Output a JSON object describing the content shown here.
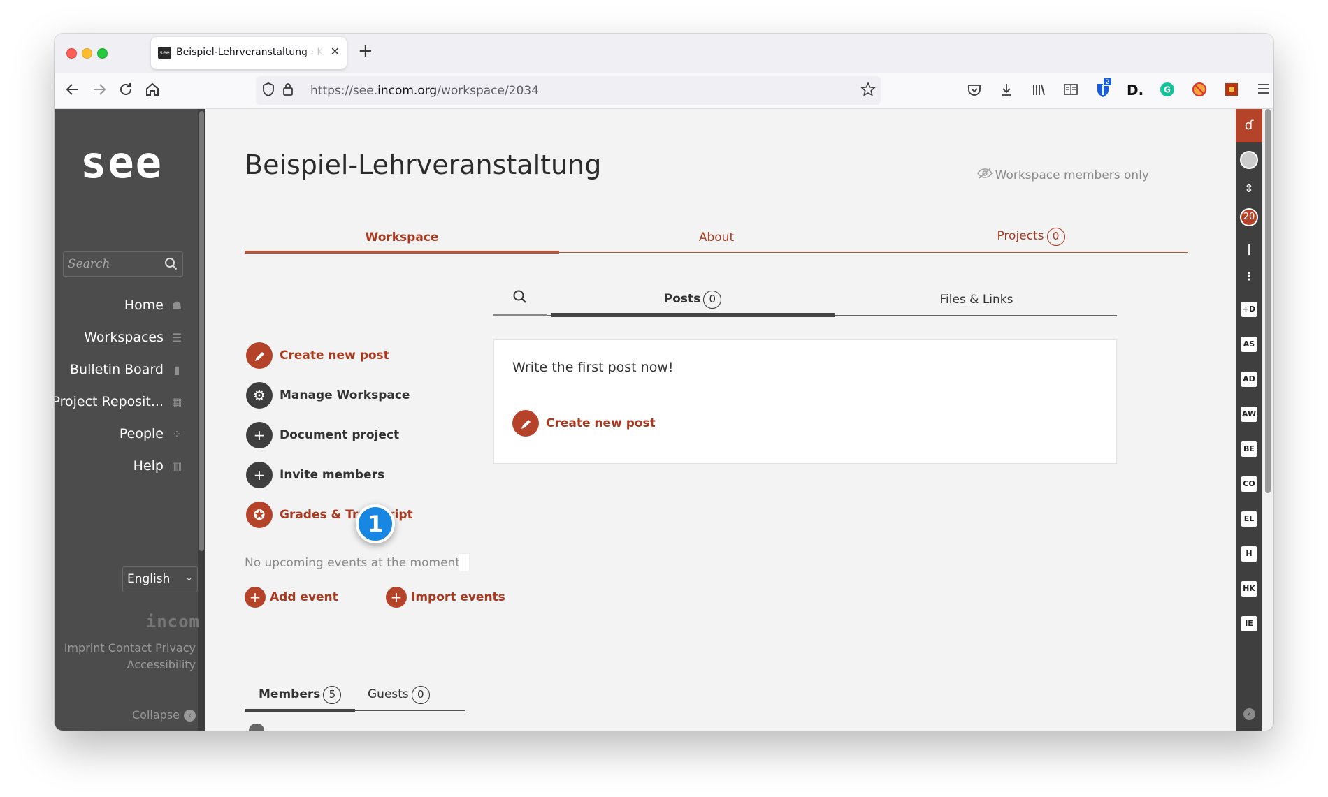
{
  "browser": {
    "tab_title": "Beispiel-Lehrveranstaltung · KHI",
    "favicon_text": "see",
    "url_prefix": "https://see.",
    "url_domain": "incom.org",
    "url_path": "/workspace/2034",
    "toolbar_icons": [
      "pocket-icon",
      "download-icon",
      "library-icon",
      "reader-icon",
      "bitwarden-icon",
      "dashlane-icon",
      "grammarly-icon",
      "blocker-icon",
      "extension-icon",
      "menu-icon"
    ],
    "bitwarden_badge": "2"
  },
  "sidebar": {
    "logo": "see",
    "search_placeholder": "Search",
    "items": [
      {
        "label": "Home",
        "icon": "home-icon"
      },
      {
        "label": "Workspaces",
        "icon": "list-icon"
      },
      {
        "label": "Bulletin Board",
        "icon": "clipboard-icon"
      },
      {
        "label": "Project Reposit...",
        "icon": "grid-icon"
      },
      {
        "label": "People",
        "icon": "people-icon"
      },
      {
        "label": "Help",
        "icon": "book-icon"
      }
    ],
    "language": "English",
    "brand": "incom",
    "footer_line1": "Imprint Contact Privacy",
    "footer_line2": "Accessibility",
    "collapse": "Collapse"
  },
  "workspace": {
    "title": "Beispiel-Lehrveranstaltung",
    "visibility": "Workspace members only",
    "tabs": [
      {
        "label": "Workspace",
        "count": null
      },
      {
        "label": "About",
        "count": null
      },
      {
        "label": "Projects",
        "count": "0"
      }
    ],
    "actions": [
      {
        "label": "Create new post",
        "icon": "pencil-icon",
        "style": "red"
      },
      {
        "label": "Manage Workspace",
        "icon": "gear-icon",
        "style": "dark"
      },
      {
        "label": "Document project",
        "icon": "plus-icon",
        "style": "dark"
      },
      {
        "label": "Invite members",
        "icon": "plus-icon",
        "style": "dark"
      },
      {
        "label": "Grades & Transcript",
        "icon": "award-icon",
        "style": "red"
      }
    ],
    "events": {
      "none_text": "No upcoming events at the moment",
      "add": "Add event",
      "import": "Import events"
    },
    "member_tabs": [
      {
        "label": "Members",
        "count": "5"
      },
      {
        "label": "Guests",
        "count": "0"
      }
    ]
  },
  "feed": {
    "tabs": [
      {
        "label": "Posts",
        "count": "0"
      },
      {
        "label": "Files & Links",
        "count": null
      }
    ],
    "empty_prompt": "Write the first post now!",
    "create_label": "Create new post"
  },
  "callout": {
    "number": "1"
  },
  "right_strip": {
    "top_glyph": "ɗ",
    "badge_count": "20",
    "items": [
      "+D",
      "AS",
      "AD",
      "AW",
      "BE",
      "CO",
      "EL",
      "H",
      "HK",
      "IE"
    ]
  },
  "colors": {
    "accent": "#b5432a",
    "accent_text": "#a8391f",
    "sidebar_bg": "#4c4c4c",
    "callout": "#1787e3"
  }
}
